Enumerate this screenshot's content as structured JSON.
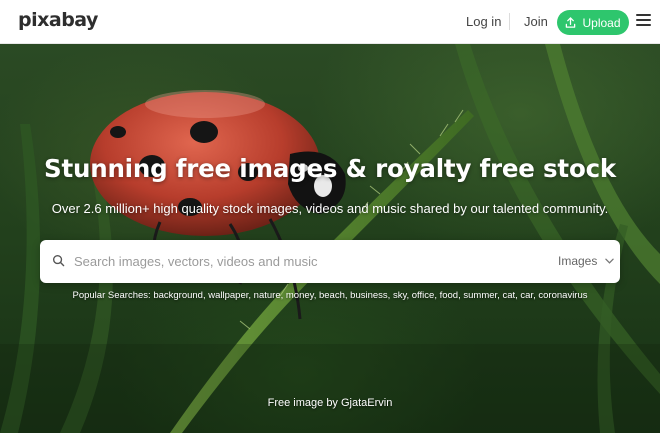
{
  "header": {
    "logo": "pixabay",
    "login": "Log in",
    "join": "Join",
    "upload": "Upload"
  },
  "hero": {
    "headline": "Stunning free images & royalty free stock",
    "subline": "Over 2.6 million+ high quality stock images, videos and music shared by our talented community.",
    "search": {
      "placeholder": "Search images, vectors, videos and music",
      "type_selected": "Images"
    },
    "popular": {
      "label": "Popular Searches:",
      "terms": [
        "background",
        "wallpaper",
        "nature",
        "money",
        "beach",
        "business",
        "sky",
        "office",
        "food",
        "summer",
        "cat",
        "car",
        "coronavirus"
      ]
    },
    "credit": {
      "prefix": "Free image by",
      "author": "GjataErvin"
    }
  },
  "colors": {
    "accent": "#2ec66d",
    "header_bg": "#ffffff"
  },
  "icons": {
    "upload": "upload-icon",
    "menu": "hamburger-menu-icon",
    "search": "search-icon",
    "dropdown": "chevron-down-icon"
  }
}
